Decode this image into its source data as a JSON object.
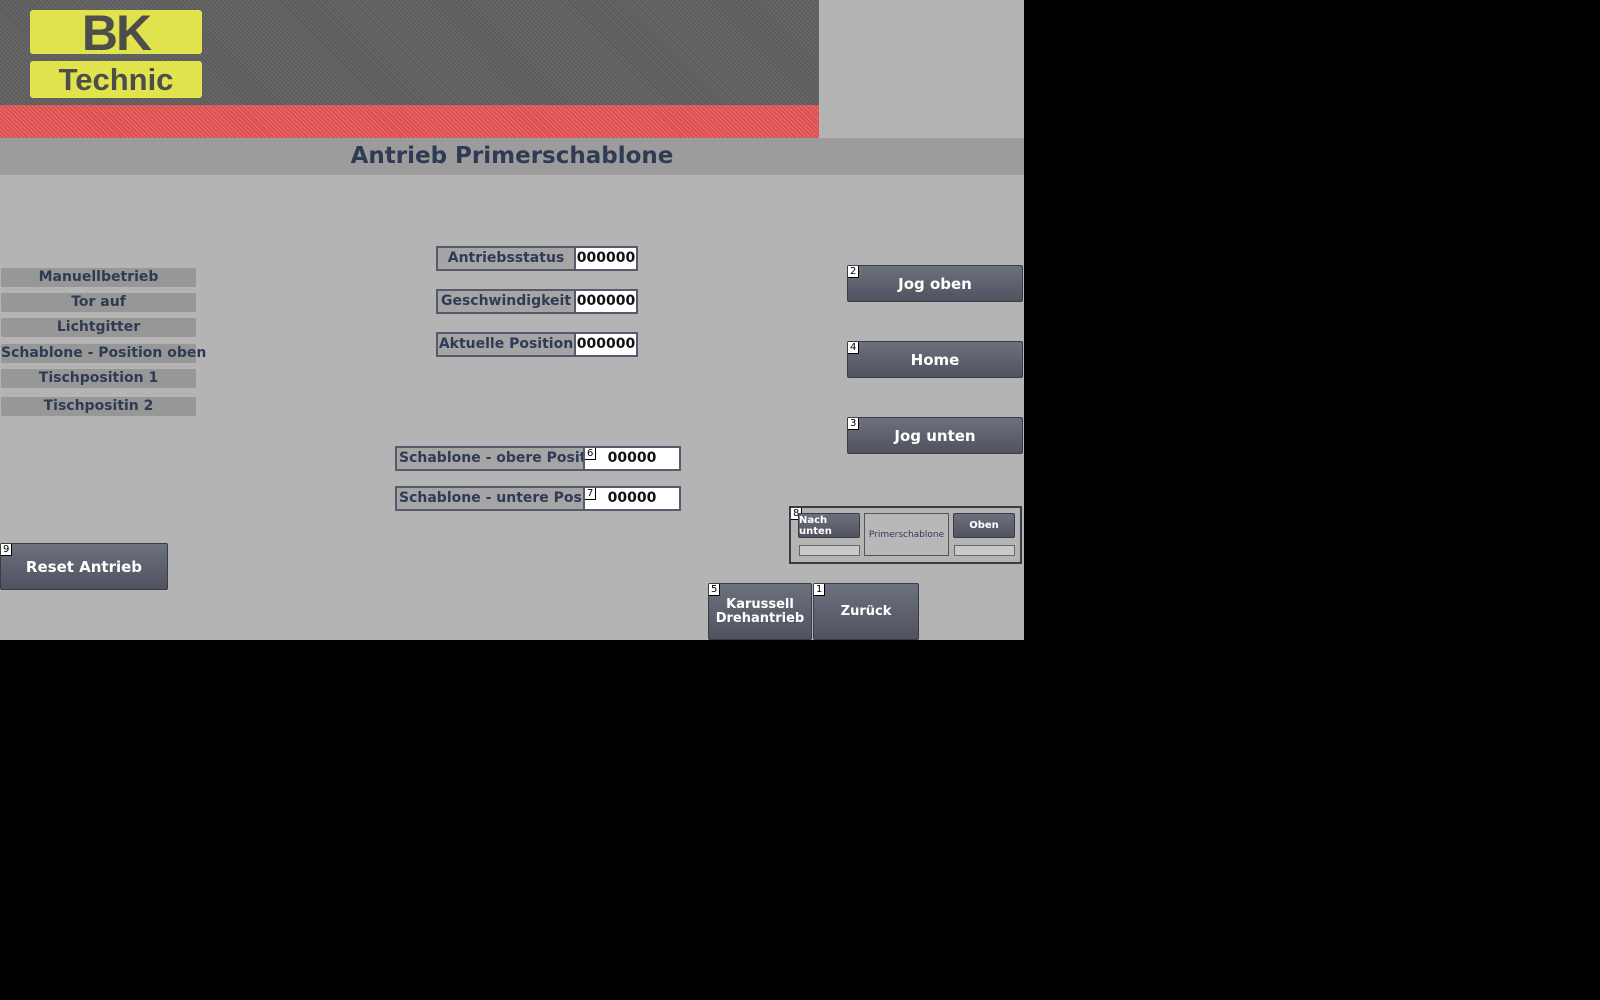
{
  "header": {
    "logo_top": "BK",
    "logo_bottom": "Technic",
    "title": "Antrieb Primerschablone"
  },
  "status_list": [
    "Manuellbetrieb",
    "Tor auf",
    "Lichtgitter",
    "Schablone - Position oben",
    "Tischposition 1",
    "Tischpositin 2"
  ],
  "fields": {
    "antriebsstatus": {
      "label": "Antriebsstatus",
      "value": "000000"
    },
    "geschwindigkeit": {
      "label": "Geschwindigkeit",
      "value": "000000"
    },
    "aktuelle_position": {
      "label": "Aktuelle Position",
      "value": "000000"
    },
    "obere_position": {
      "label": "Schablone - obere Position",
      "badge": "6",
      "value": "00000"
    },
    "untere_position": {
      "label": "Schablone - untere Position",
      "badge": "7",
      "value": "00000"
    }
  },
  "buttons": {
    "jog_oben": {
      "label": "Jog oben",
      "badge": "2"
    },
    "home": {
      "label": "Home",
      "badge": "4"
    },
    "jog_unten": {
      "label": "Jog unten",
      "badge": "3"
    },
    "reset": {
      "label": "Reset Antrieb",
      "badge": "9"
    },
    "karussell": {
      "label": "Karussell\nDrehantrieb",
      "badge": "5"
    },
    "zurueck": {
      "label": "Zurück",
      "badge": "1"
    }
  },
  "control_group": {
    "badge": "8",
    "left_button": "Nach unten",
    "center_label": "Primerschablone",
    "right_button": "Oben"
  },
  "colors": {
    "background": "#b4b4b4",
    "title_text": "#2f3b55",
    "banner_red": "#de4f4f",
    "logo_yellow": "#e1e34c"
  }
}
